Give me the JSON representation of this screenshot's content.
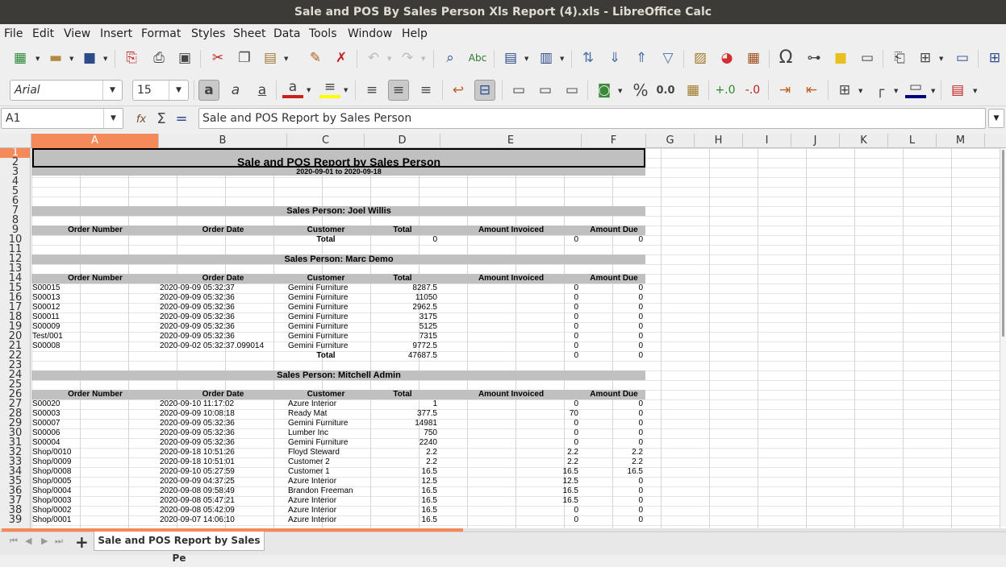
{
  "window": {
    "title": "Sale and POS By Sales Person Xls Report (4).xls - LibreOffice Calc"
  },
  "menu": [
    "File",
    "Edit",
    "View",
    "Insert",
    "Format",
    "Styles",
    "Sheet",
    "Data",
    "Tools",
    "Window",
    "Help"
  ],
  "toolbar2": {
    "font_name": "Arial",
    "font_size": "15",
    "percent": "%",
    "decimal": "0.0"
  },
  "formula": {
    "name_box": "A1",
    "content": "Sale and POS Report by Sales Person",
    "fx": "fx",
    "sum": "Σ",
    "eq": "="
  },
  "columns": [
    "A",
    "B",
    "C",
    "D",
    "E",
    "F",
    "G",
    "H",
    "I",
    "J",
    "K",
    "L",
    "M"
  ],
  "rows": [
    "1",
    "2",
    "3",
    "4",
    "5",
    "6",
    "7",
    "8",
    "9",
    "10",
    "11",
    "12",
    "13",
    "14",
    "15",
    "16",
    "17",
    "18",
    "19",
    "20",
    "21",
    "22",
    "23",
    "24",
    "25",
    "26",
    "27",
    "28",
    "29",
    "30",
    "31",
    "32",
    "33",
    "34",
    "35",
    "36",
    "37",
    "38",
    "39"
  ],
  "report": {
    "title": "Sale and POS Report by Sales Person",
    "date_range": "2020-09-01 to 2020-09-18",
    "headers": [
      "Order Number",
      "Order Date",
      "Customer",
      "Total",
      "Amount Invoiced",
      "Amount Due"
    ],
    "total_label": "Total",
    "sections": [
      {
        "title": "Sales Person: Joel Willis",
        "rows": [],
        "totals": [
          "0",
          "0",
          "0"
        ]
      },
      {
        "title": "Sales Person: Marc Demo",
        "rows": [
          [
            "S00015",
            "2020-09-09 05:32:37",
            "Gemini Furniture",
            "8287.5",
            "0",
            "0"
          ],
          [
            "S00013",
            "2020-09-09 05:32:36",
            "Gemini Furniture",
            "11050",
            "0",
            "0"
          ],
          [
            "S00012",
            "2020-09-09 05:32:36",
            "Gemini Furniture",
            "2962.5",
            "0",
            "0"
          ],
          [
            "S00011",
            "2020-09-09 05:32:36",
            "Gemini Furniture",
            "3175",
            "0",
            "0"
          ],
          [
            "S00009",
            "2020-09-09 05:32:36",
            "Gemini Furniture",
            "5125",
            "0",
            "0"
          ],
          [
            "Test/001",
            "2020-09-09 05:32:36",
            "Gemini Furniture",
            "7315",
            "0",
            "0"
          ],
          [
            "S00008",
            "2020-09-02 05:32:37.099014",
            "Gemini Furniture",
            "9772.5",
            "0",
            "0"
          ]
        ],
        "totals": [
          "47687.5",
          "0",
          "0"
        ]
      },
      {
        "title": "Sales Person: Mitchell Admin",
        "rows": [
          [
            "S00020",
            "2020-09-10 11:17:02",
            "Azure Interior",
            "1",
            "0",
            "0"
          ],
          [
            "S00003",
            "2020-09-09 10:08:18",
            "Ready Mat",
            "377.5",
            "70",
            "0"
          ],
          [
            "S00007",
            "2020-09-09 05:32:36",
            "Gemini Furniture",
            "14981",
            "0",
            "0"
          ],
          [
            "S00006",
            "2020-09-09 05:32:36",
            "Lumber Inc",
            "750",
            "0",
            "0"
          ],
          [
            "S00004",
            "2020-09-09 05:32:36",
            "Gemini Furniture",
            "2240",
            "0",
            "0"
          ],
          [
            "Shop/0010",
            "2020-09-18 10:51:26",
            "Floyd Steward",
            "2.2",
            "2.2",
            "2.2"
          ],
          [
            "Shop/0009",
            "2020-09-18 10:51:01",
            "Customer 2",
            "2.2",
            "2.2",
            "2.2"
          ],
          [
            "Shop/0008",
            "2020-09-10 05:27:59",
            "Customer 1",
            "16.5",
            "16.5",
            "16.5"
          ],
          [
            "Shop/0005",
            "2020-09-09 04:37:25",
            "Azure Interior",
            "12.5",
            "12.5",
            "0"
          ],
          [
            "Shop/0004",
            "2020-09-08 09:58:49",
            "Brandon Freeman",
            "16.5",
            "16.5",
            "0"
          ],
          [
            "Shop/0003",
            "2020-09-08 05:47:21",
            "Azure Interior",
            "16.5",
            "16.5",
            "0"
          ],
          [
            "Shop/0002",
            "2020-09-08 05:42:09",
            "Azure Interior",
            "16.5",
            "0",
            "0"
          ],
          [
            "Shop/0001",
            "2020-09-07 14:06:10",
            "Azure Interior",
            "16.5",
            "0",
            "0"
          ]
        ]
      }
    ]
  },
  "sheet_tab": {
    "label": "Sale and POS Report by Sales Pe",
    "add": "+"
  }
}
